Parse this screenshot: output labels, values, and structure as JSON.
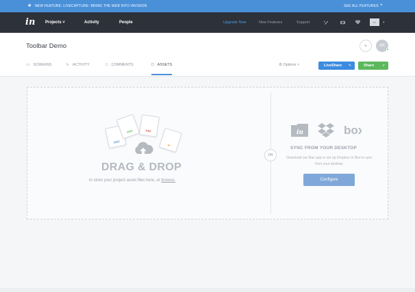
{
  "banner": {
    "prefix": "NEW FEATURE:",
    "message": "LIVECAPTURE: BRING THE WEB INTO INVISION",
    "right_label": "SEE ALL FEATURES",
    "close": "×"
  },
  "nav": {
    "logo": "in",
    "items": [
      {
        "label": "Projects ˅"
      },
      {
        "label": "Activity"
      },
      {
        "label": "People"
      }
    ],
    "upgrade": "Upgrade Now",
    "new_features": "New Features",
    "support": "Support",
    "avatar_initials": "AK"
  },
  "header": {
    "title": "Toolbar Demo",
    "plus": "+",
    "avatar": "AK",
    "tabs": [
      {
        "label": "Screens"
      },
      {
        "label": "Activity"
      },
      {
        "label": "Comments"
      },
      {
        "label": "Assets"
      }
    ],
    "options": "Options ˅",
    "liveshare": "LiveShare",
    "share": "Share"
  },
  "dropzone": {
    "files": [
      "DOC",
      "PNG",
      "PDF",
      "Ai"
    ],
    "title": "DRAG & DROP",
    "subtitle_prefix": "to store your project asset files here, or",
    "browse": "browse.",
    "or": "OR",
    "sync_title": "SYNC FROM YOUR DESKTOP",
    "sync_desc": "Download our Mac app or set up Dropbox or Box to sync from your desktop.",
    "configure": "Configure",
    "brand_in": "in",
    "brand_box": "box"
  }
}
